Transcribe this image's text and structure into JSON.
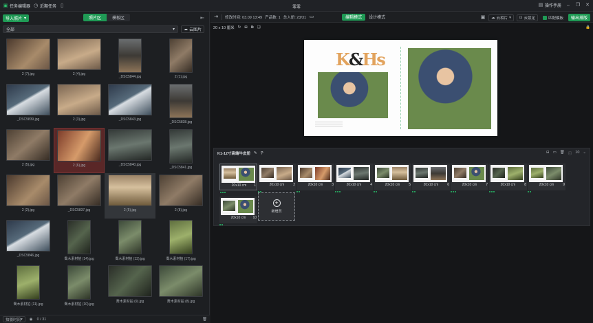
{
  "titlebar": {
    "task_label": "任务编辑器",
    "recent_label": "近期任务",
    "app_title": "零零",
    "manual_label": "操作手册"
  },
  "left": {
    "import_label": "导入照片",
    "tabs": [
      "照片区",
      "模板区"
    ],
    "filter_value": "全部",
    "cloud_label": "云图片",
    "photos": [
      {
        "caption": "2 (7).jpg",
        "fill": "ph1",
        "shape": "land",
        "state": ""
      },
      {
        "caption": "2 (4).jpg",
        "fill": "ph2",
        "shape": "land",
        "state": ""
      },
      {
        "caption": "_DSC5844.jpg",
        "fill": "ph3",
        "shape": "portrait",
        "state": ""
      },
      {
        "caption": "2 (1).jpg",
        "fill": "ph5",
        "shape": "portrait",
        "state": ""
      },
      {
        "caption": "_DSC5839.jpg",
        "fill": "ph4",
        "shape": "land",
        "state": ""
      },
      {
        "caption": "2 (3).jpg",
        "fill": "ph2",
        "shape": "land",
        "state": ""
      },
      {
        "caption": "_DSC5843.jpg",
        "fill": "ph4",
        "shape": "land",
        "state": ""
      },
      {
        "caption": "_DSC5838.jpg",
        "fill": "ph3",
        "shape": "portrait",
        "state": ""
      },
      {
        "caption": "2 (5).jpg",
        "fill": "ph5",
        "shape": "land",
        "state": ""
      },
      {
        "caption": "2 (6).jpg",
        "fill": "ph6",
        "shape": "land",
        "state": "sel"
      },
      {
        "caption": "_DSC5840.jpg",
        "fill": "ph7",
        "shape": "land",
        "state": ""
      },
      {
        "caption": "_DSC5841.jpg",
        "fill": "ph7",
        "shape": "portrait",
        "state": ""
      },
      {
        "caption": "2 (2).jpg",
        "fill": "ph1",
        "shape": "land",
        "state": ""
      },
      {
        "caption": "_DSC5837.jpg",
        "fill": "ph5",
        "shape": "land",
        "state": ""
      },
      {
        "caption": "2 (5).jpg",
        "fill": "ph8",
        "shape": "land",
        "state": "hov"
      },
      {
        "caption": "2 (8).jpg",
        "fill": "ph5",
        "shape": "land",
        "state": ""
      },
      {
        "caption": "_DSC5846.jpg",
        "fill": "ph4",
        "shape": "land",
        "state": ""
      },
      {
        "caption": "喬木素材拍 (14).jpg",
        "fill": "ph10",
        "shape": "portrait",
        "state": ""
      },
      {
        "caption": "喬木素材拍 (13).jpg",
        "fill": "ph9",
        "shape": "portrait",
        "state": ""
      },
      {
        "caption": "喬木素材拍 (17).jpg",
        "fill": "ph12",
        "shape": "portrait",
        "state": ""
      },
      {
        "caption": "喬木素材拍 (11).jpg",
        "fill": "ph12",
        "shape": "portrait",
        "state": ""
      },
      {
        "caption": "喬木素材拍 (10).jpg",
        "fill": "ph9",
        "shape": "portrait",
        "state": ""
      },
      {
        "caption": "喬木素材拍 (9).jpg",
        "fill": "ph10",
        "shape": "land",
        "state": ""
      },
      {
        "caption": "喬木素材拍 (8).jpg",
        "fill": "ph9",
        "shape": "land",
        "state": ""
      }
    ],
    "status_sort": "拍摄时间",
    "status_count": "0 / 31"
  },
  "right": {
    "modify_label": "修改时间: 03.09 13:49",
    "product_label": "产品数: 1",
    "pages_label": "总入册: 23/31",
    "mode_on": "编辑模式",
    "mode_off": "设计模式",
    "cloud_label": "云相片",
    "cloud_lock_label": "云锁定",
    "match_label": "匹配模板",
    "export_label": "输出排版",
    "size_label": "20 x 10 厘米",
    "pages_title": "K1-12寸高端牛皮册",
    "pages_count": "10",
    "pages": [
      {
        "size": "20x10 cm",
        "num": "1",
        "a": "ph8",
        "b": "ph11",
        "dots": 3
      },
      {
        "size": "20x10 cm",
        "num": "2",
        "a": "ph5",
        "b": "ph2",
        "dots": 2
      },
      {
        "size": "20x10 cm",
        "num": "3",
        "a": "ph1",
        "b": "ph6",
        "dots": 2
      },
      {
        "size": "20x10 cm",
        "num": "4",
        "a": "ph4",
        "b": "ph7",
        "dots": 3
      },
      {
        "size": "20x10 cm",
        "num": "5",
        "a": "ph9",
        "b": "ph8",
        "dots": 2
      },
      {
        "size": "20x10 cm",
        "num": "6",
        "a": "ph7",
        "b": "ph3",
        "dots": 2
      },
      {
        "size": "20x10 cm",
        "num": "7",
        "a": "ph5",
        "b": "ph11",
        "dots": 3
      },
      {
        "size": "20x10 cm",
        "num": "8",
        "a": "ph10",
        "b": "ph12",
        "dots": 3
      },
      {
        "size": "20x10 cm",
        "num": "9",
        "a": "ph12",
        "b": "ph9",
        "dots": 2
      },
      {
        "size": "20x10 cm",
        "num": "10",
        "a": "ph9",
        "b": "ph11",
        "dots": 2
      }
    ],
    "add_page_label": "新增页"
  }
}
